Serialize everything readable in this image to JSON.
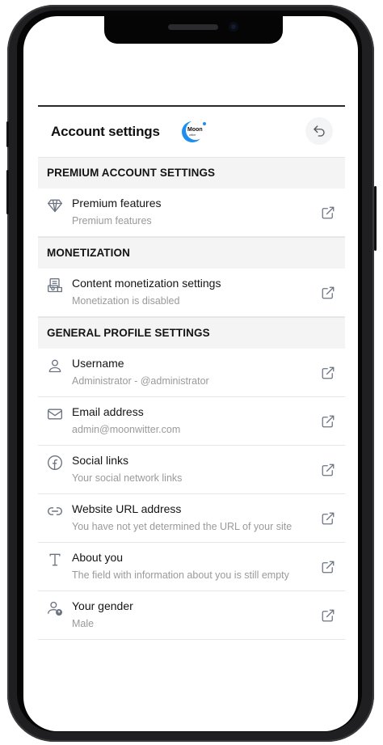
{
  "header": {
    "title": "Account settings",
    "logo_text": "Moon",
    "logo_subtext": "witter"
  },
  "sections": [
    {
      "heading": "PREMIUM ACCOUNT SETTINGS",
      "items": [
        {
          "title": "Premium features",
          "subtitle": "Premium features",
          "icon": "diamond-icon"
        }
      ]
    },
    {
      "heading": "MONETIZATION",
      "items": [
        {
          "title": "Content monetization settings",
          "subtitle": "Monetization is disabled",
          "icon": "monetization-icon"
        }
      ]
    },
    {
      "heading": "GENERAL PROFILE SETTINGS",
      "items": [
        {
          "title": "Username",
          "subtitle": "Administrator - @administrator",
          "icon": "user-icon"
        },
        {
          "title": "Email address",
          "subtitle": "admin@moonwitter.com",
          "icon": "mail-icon"
        },
        {
          "title": "Social links",
          "subtitle": "Your social network links",
          "icon": "facebook-icon"
        },
        {
          "title": "Website URL address",
          "subtitle": "You have not yet determined the URL of your site",
          "icon": "link-icon"
        },
        {
          "title": "About you",
          "subtitle": "The field with information about you is still empty",
          "icon": "text-icon"
        },
        {
          "title": "Your gender",
          "subtitle": "Male",
          "icon": "gender-icon"
        }
      ]
    }
  ],
  "colors": {
    "icon": "#6b7280",
    "subtitle": "#9a9a9a",
    "section_bg": "#f4f4f5",
    "logo_blue": "#1d8ff0"
  }
}
